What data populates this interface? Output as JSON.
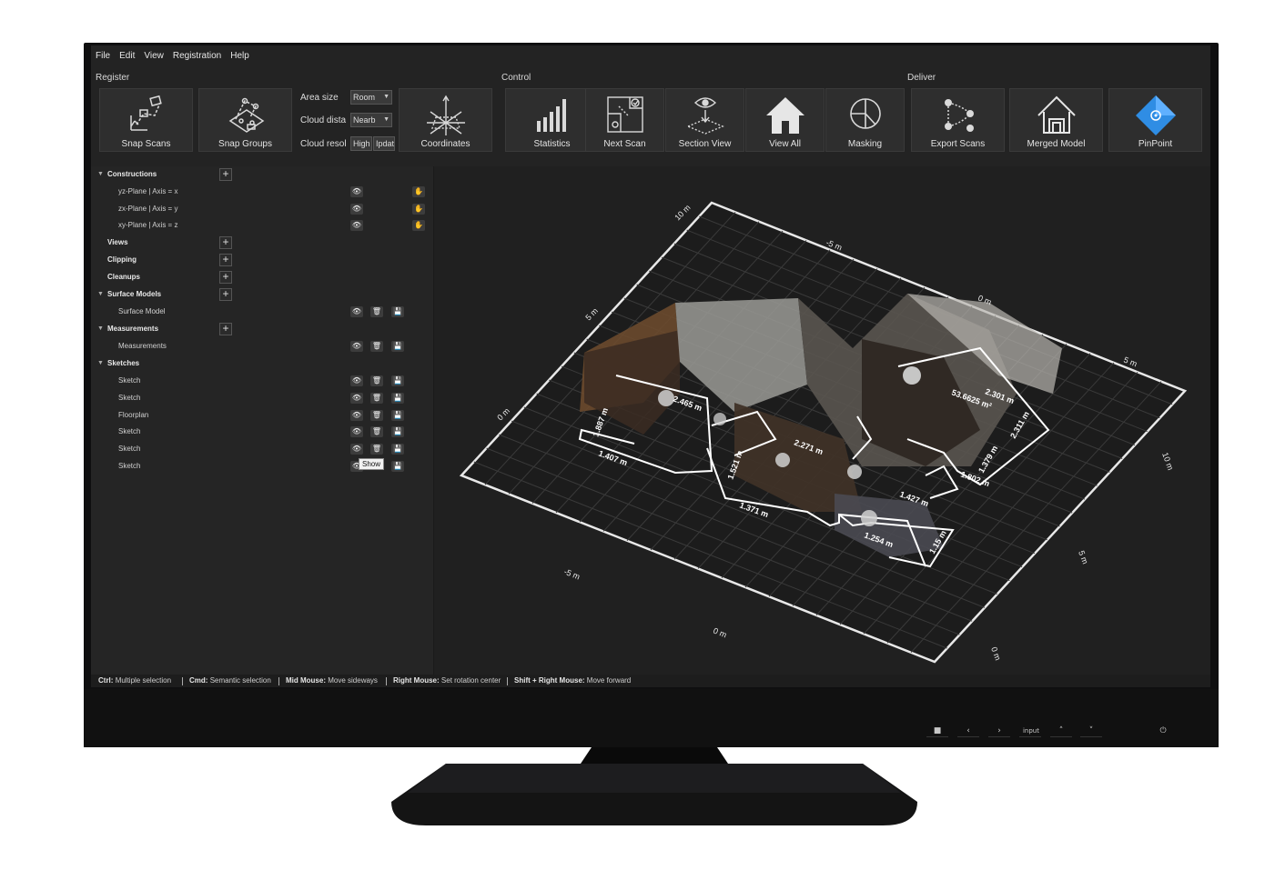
{
  "menu": [
    "File",
    "Edit",
    "View",
    "Registration",
    "Help"
  ],
  "groups": {
    "register": "Register",
    "control": "Control",
    "deliver": "Deliver"
  },
  "tools": {
    "snap_scans": "Snap Scans",
    "snap_groups": "Snap Groups",
    "coordinates": "Coordinates",
    "statistics": "Statistics",
    "next_scan": "Next Scan",
    "section_view": "Section View",
    "view_all": "View All",
    "masking": "Masking",
    "export_scans": "Export Scans",
    "merged_model": "Merged Model",
    "pinpoint": "PinPoint"
  },
  "fields": {
    "area_size": {
      "label": "Area size",
      "value": "Room"
    },
    "cloud_distance": {
      "label": "Cloud dista",
      "value": "Nearb"
    },
    "cloud_resolution": {
      "label": "Cloud resol",
      "value": "High",
      "value2": "Ipdat"
    }
  },
  "tree": {
    "constructions": "Constructions",
    "yz": "yz-Plane | Axis = x",
    "zx": "zx-Plane | Axis = y",
    "xy": "xy-Plane | Axis = z",
    "views": "Views",
    "clipping": "Clipping",
    "cleanups": "Cleanups",
    "surface_models": "Surface Models",
    "surface_model": "Surface Model",
    "measurements": "Measurements",
    "measurements_item": "Measurements",
    "sketches": "Sketches",
    "sketch_items": [
      "Sketch",
      "Sketch",
      "Floorplan",
      "Sketch",
      "Sketch",
      "Sketch"
    ],
    "tooltip": "Show"
  },
  "viewport": {
    "grid_labels": {
      "top_10m": "10 m",
      "top_neg5m": "-5 m",
      "top_0m": "0 m",
      "top_5m": "5 m",
      "left_5m": "5 m",
      "left_0m": "0 m",
      "bottom_neg5m": "-5 m",
      "bottom_0m": "0 m",
      "bottom_5m": "5 m",
      "right_10m": "10 m",
      "right_5m": "5 m",
      "right_0m": "0 m"
    },
    "measures": {
      "area": "53.6625 m²",
      "m1": "2.301 m",
      "m2": "2.311 m",
      "m3": "1.802 m",
      "m4": "1.379 m",
      "m5": "1.427 m",
      "m6": "1.254 m",
      "m7": "1.15 m",
      "m8": "1.371 m",
      "m9": "1.521 m",
      "m10": "2.271 m",
      "m11": "1.887 m",
      "m12": "1.407 m",
      "m13": "2.465 m"
    }
  },
  "status": {
    "ctrl_key": "Ctrl:",
    "ctrl_val": "Multiple selection",
    "cmd_key": "Cmd:",
    "cmd_val": "Semantic selection",
    "mid_key": "Mid Mouse:",
    "mid_val": "Move sideways",
    "right_key": "Right Mouse:",
    "right_val": "Set rotation center",
    "shift_key": "Shift + Right Mouse:",
    "shift_val": "Move forward"
  },
  "monitor_buttons": {
    "input": "input"
  },
  "colors": {
    "pinpoint": "#2f8de4",
    "background": "#232323",
    "panel": "#2e2e2e"
  }
}
